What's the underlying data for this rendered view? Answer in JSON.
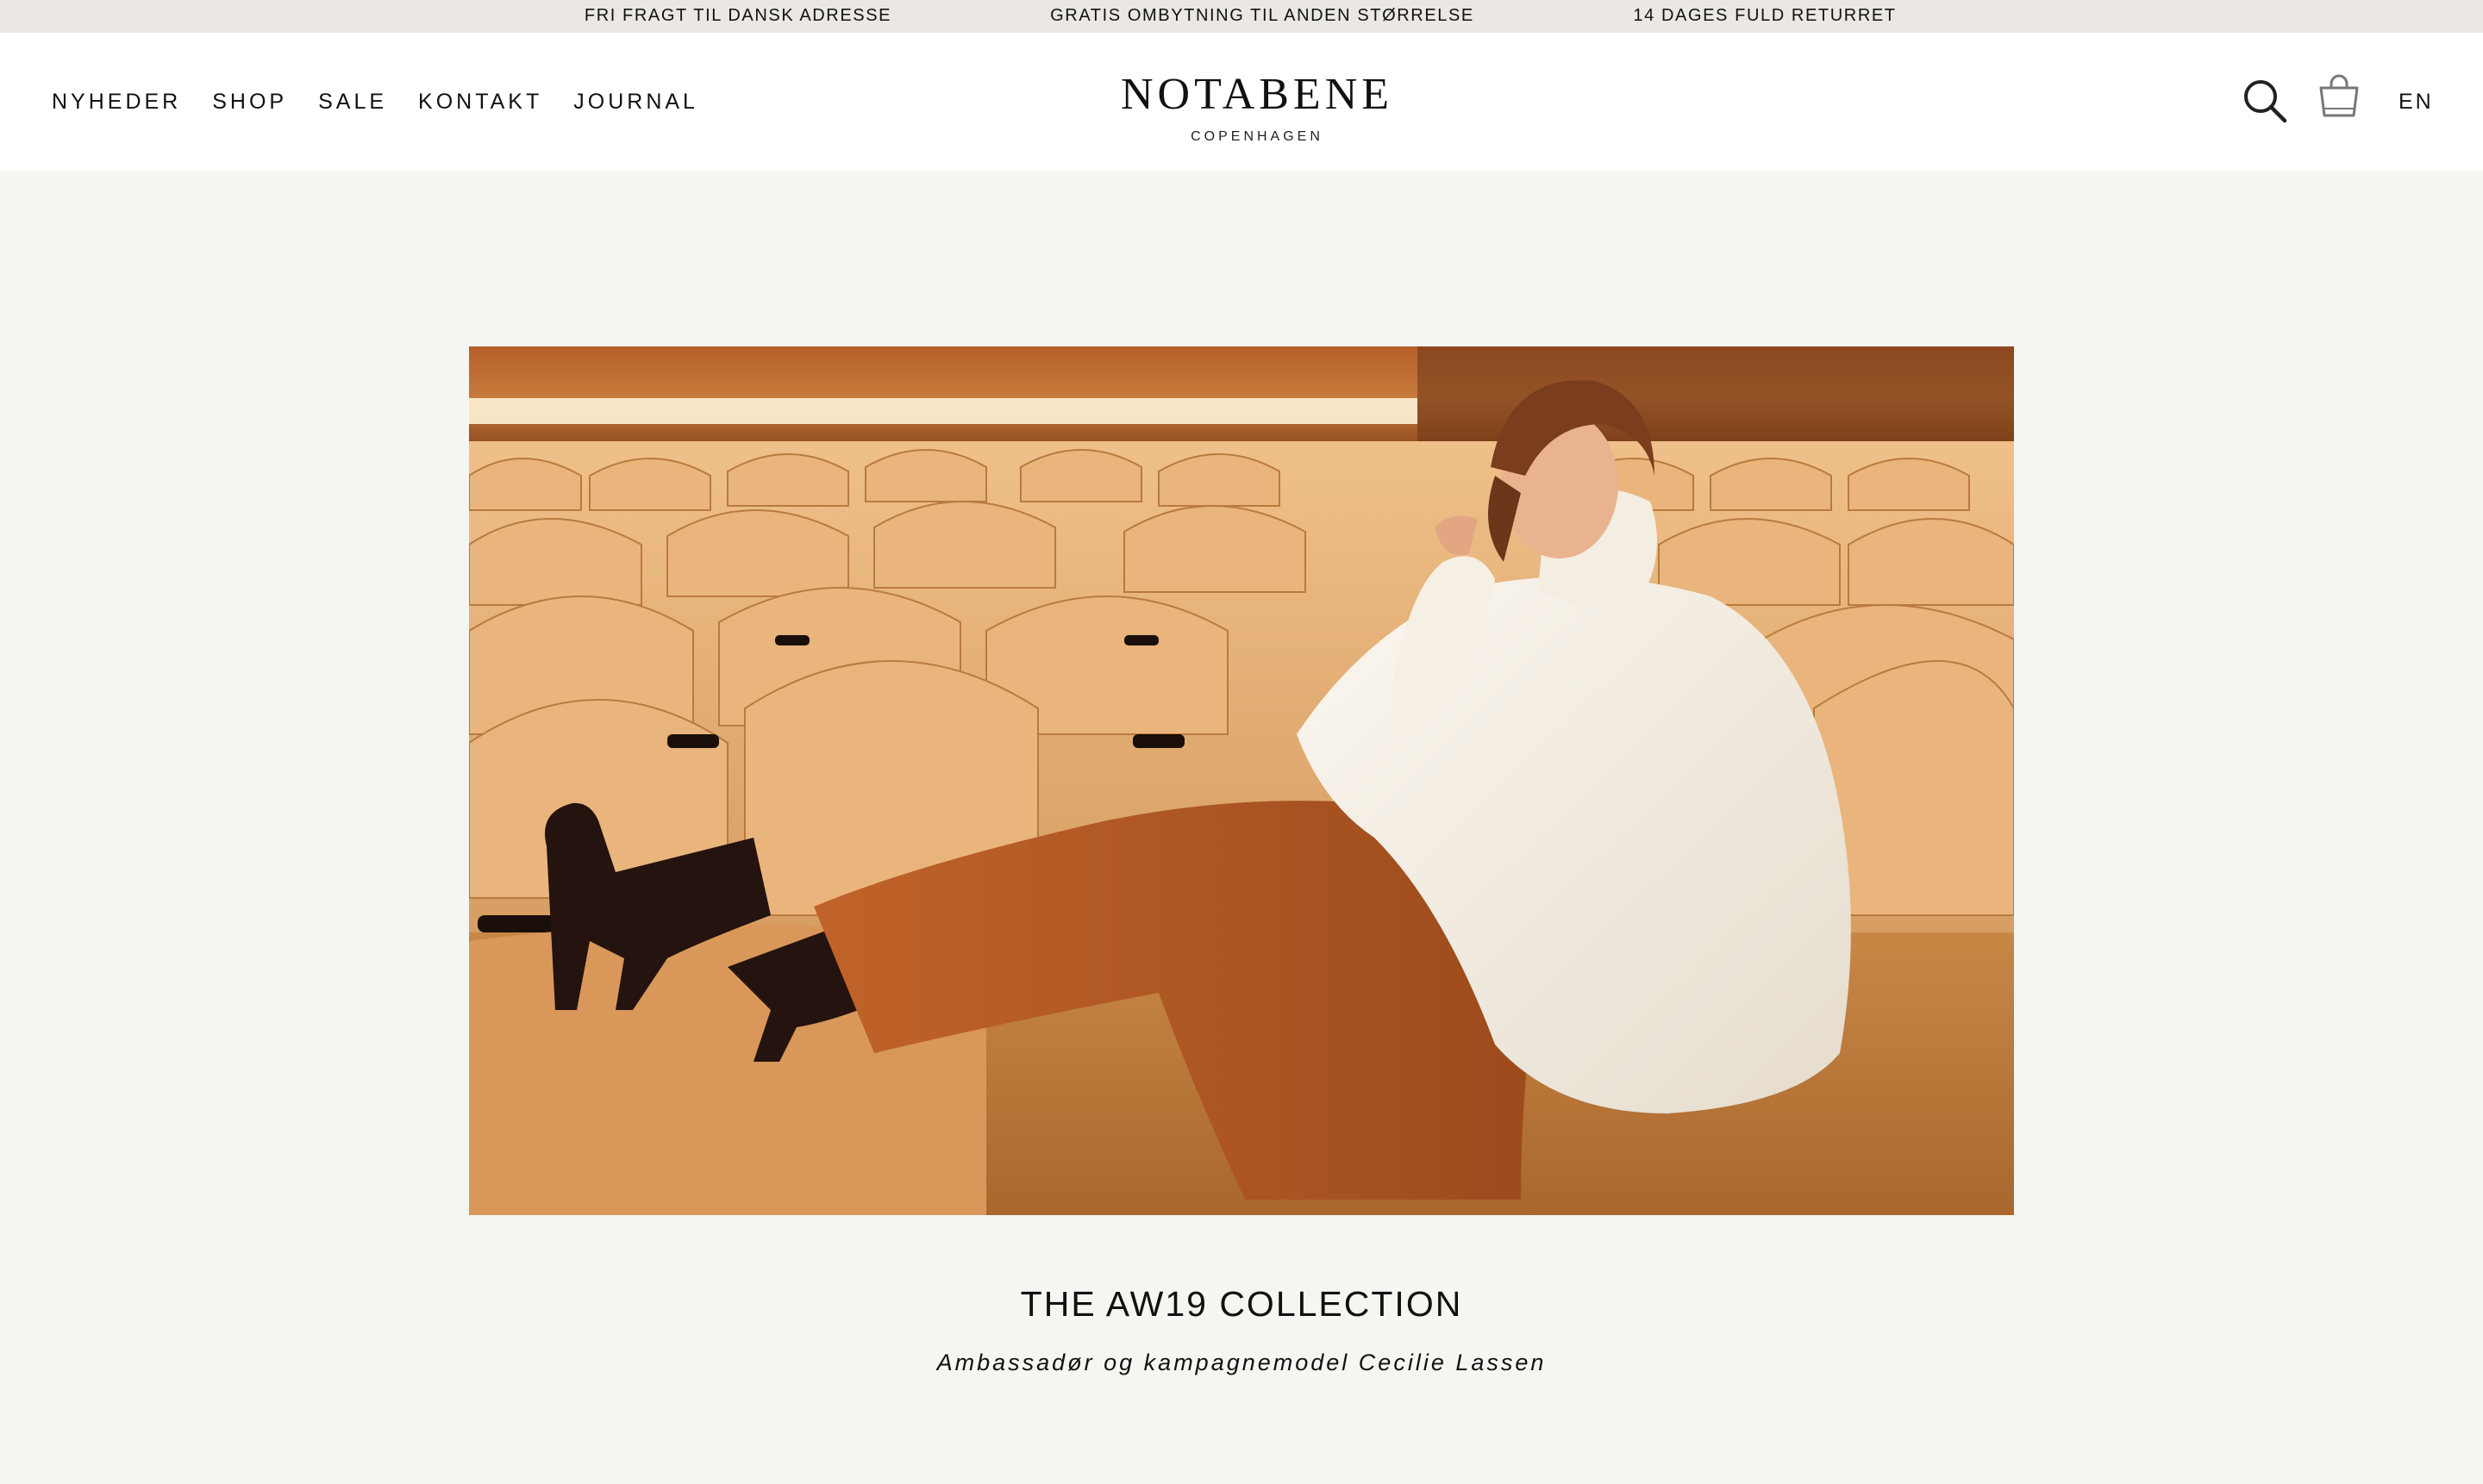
{
  "announcement_bar": {
    "items": [
      "FRI FRAGT TIL DANSK ADRESSE",
      "GRATIS OMBYTNING TIL ANDEN STØRRELSE",
      "14 DAGES FULD RETURRET"
    ]
  },
  "header": {
    "nav": [
      "NYHEDER",
      "SHOP",
      "SALE",
      "KONTAKT",
      "JOURNAL"
    ],
    "logo": {
      "brand": "NOTABENE",
      "sub": "COPENHAGEN"
    },
    "icons": {
      "search": "search-icon",
      "cart": "shopping-bag-icon"
    },
    "language": "EN"
  },
  "hero": {
    "image": "campaign-photo-woman-in-white-sweater-on-auditorium-seats",
    "title": "THE AW19 COLLECTION",
    "subtitle": "Ambassadør og kampagnemodel Cecilie Lassen"
  },
  "colors": {
    "page_background": "#f6f5f1",
    "announcement_background": "#ebe8e4",
    "header_background": "#ffffff",
    "text": "#111111"
  }
}
